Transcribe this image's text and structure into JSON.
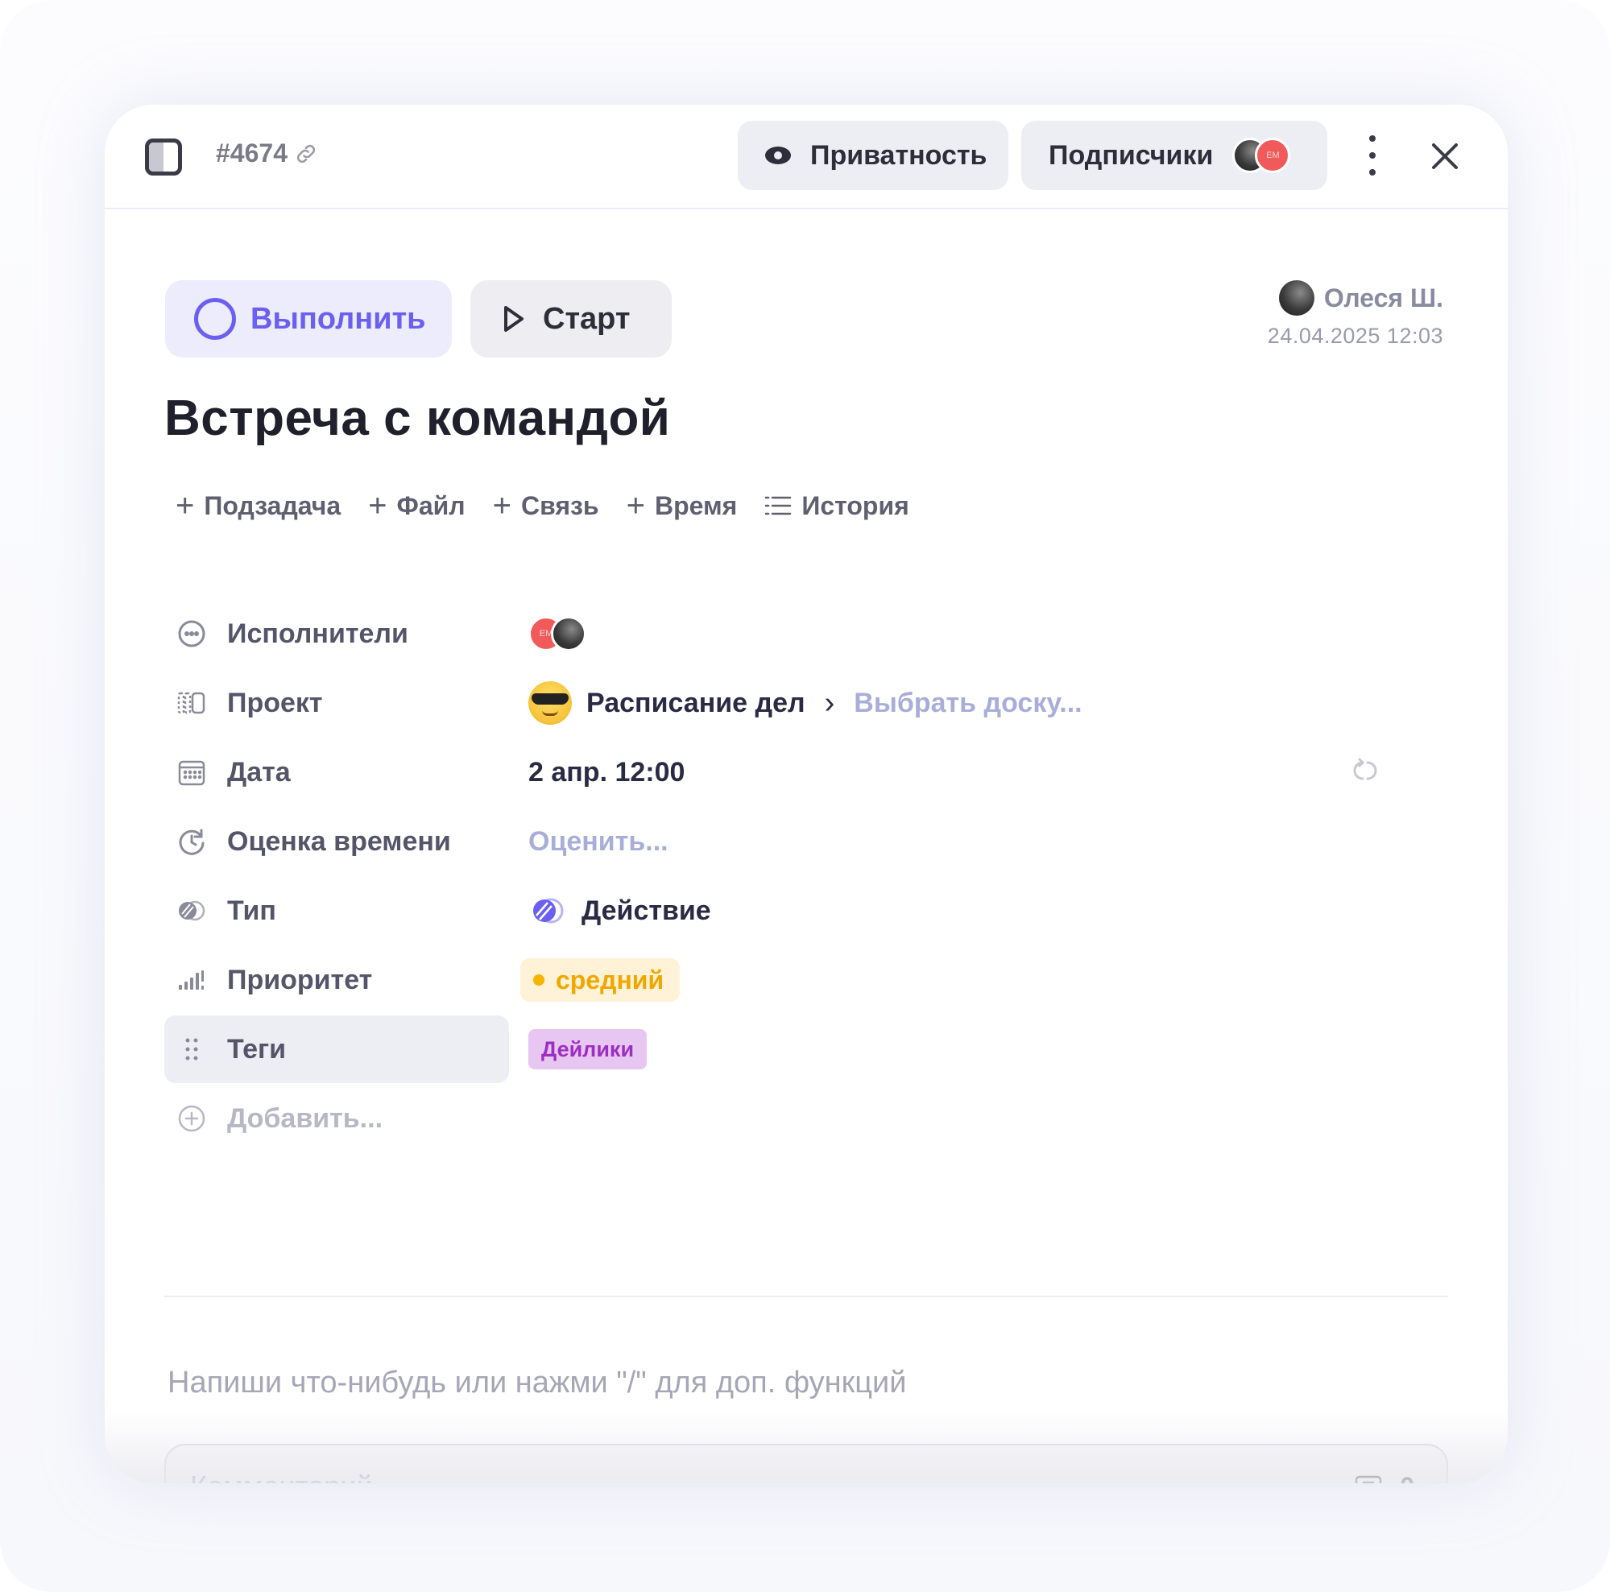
{
  "header": {
    "task_id": "#4674",
    "privacy_label": "Приватность",
    "subscribers_label": "Подписчики",
    "subscriber_avatar_initials": "ЕМ"
  },
  "actions": {
    "complete_label": "Выполнить",
    "start_label": "Старт"
  },
  "creator": {
    "name": "Олеся Ш.",
    "date": "24.04.2025 12:03"
  },
  "task": {
    "title": "Встреча с командой"
  },
  "quick_actions": [
    {
      "label": "Подзадача",
      "icon": "plus-icon"
    },
    {
      "label": "Файл",
      "icon": "plus-icon"
    },
    {
      "label": "Связь",
      "icon": "plus-icon"
    },
    {
      "label": "Время",
      "icon": "plus-icon"
    },
    {
      "label": "История",
      "icon": "list-icon"
    }
  ],
  "properties": {
    "assignees": {
      "label": "Исполнители",
      "avatar_initials": "ЕМ"
    },
    "project": {
      "label": "Проект",
      "value": "Расписание дел",
      "board_placeholder": "Выбрать доску..."
    },
    "date": {
      "label": "Дата",
      "value": "2 апр. 12:00"
    },
    "estimate": {
      "label": "Оценка времени",
      "placeholder": "Оценить..."
    },
    "type": {
      "label": "Тип",
      "value": "Действие"
    },
    "priority": {
      "label": "Приоритет",
      "value": "средний",
      "color": "#f5b400"
    },
    "tags": {
      "label": "Теги",
      "value": "Дейлики",
      "color": "#e7c6f2"
    },
    "add": {
      "label": "Добавить..."
    }
  },
  "editor": {
    "placeholder": "Напиши что-нибудь или нажми \"/\" для доп. функций"
  },
  "comment": {
    "placeholder": "Комментарий...",
    "count": "0"
  },
  "colors": {
    "accent": "#6a5ff0",
    "muted_link": "#a9aed8"
  }
}
